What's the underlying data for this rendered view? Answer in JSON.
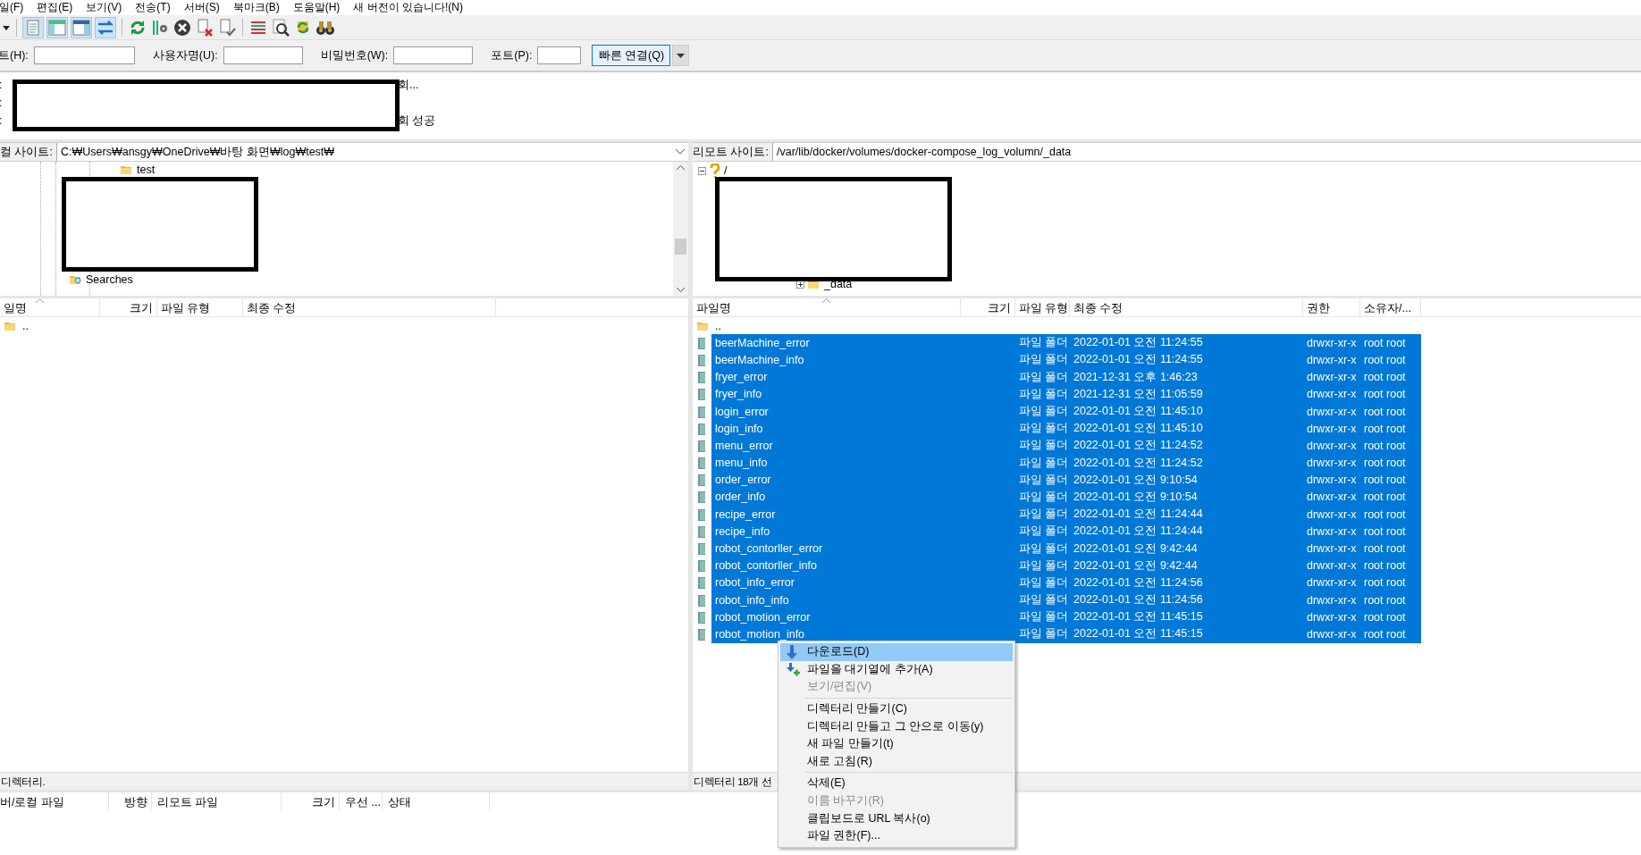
{
  "menu_bar": {
    "items": [
      "일(F)",
      "편집(E)",
      "보기(V)",
      "전송(T)",
      "서버(S)",
      "북마크(B)",
      "도움말(H)",
      "새 버전이 있습니다!(N)"
    ]
  },
  "quickconnect": {
    "fields": [
      {
        "label": "트(H):"
      },
      {
        "label": "사용자명(U):"
      },
      {
        "label": "비밀번호(W):"
      },
      {
        "label": "포트(P):"
      }
    ],
    "button": "빠른 연결(Q)"
  },
  "message_log": {
    "lines": [
      {
        "prefix": ":",
        "text": "회..."
      },
      {
        "prefix": ":"
      },
      {
        "prefix": ":",
        "text": "회 성공"
      }
    ]
  },
  "local": {
    "site_label": "컬 사이트:",
    "path": "C:₩Users₩ansgy₩OneDrive₩바탕 화면₩log₩test₩",
    "tree": [
      {
        "label": "test",
        "kind": "folder"
      },
      {
        "label": "Searches",
        "kind": "search"
      }
    ],
    "columns": [
      "일명",
      "크기",
      "파일 유형",
      "최종 수정"
    ],
    "rows": [
      {
        "name": ".."
      }
    ],
    "status": "디렉터리."
  },
  "remote": {
    "site_label": "리모트 사이트:",
    "path": "/var/lib/docker/volumes/docker-compose_log_volumn/_data",
    "tree": [
      {
        "label": "/",
        "children": [
          {
            "label": "_data"
          }
        ]
      }
    ],
    "columns": [
      "파일명",
      "크기",
      "파일 유형",
      "최종 수정",
      "권한",
      "소유자/..."
    ],
    "rows": [
      {
        "name": "..",
        "selected": false
      },
      {
        "name": "beerMachine_error",
        "type": "파일 폴더",
        "modified": "2022-01-01 오전 11:24:55",
        "permissions": "drwxr-xr-x",
        "owner": "root root",
        "selected": true
      },
      {
        "name": "beerMachine_info",
        "type": "파일 폴더",
        "modified": "2022-01-01 오전 11:24:55",
        "permissions": "drwxr-xr-x",
        "owner": "root root",
        "selected": true
      },
      {
        "name": "fryer_error",
        "type": "파일 폴더",
        "modified": "2021-12-31 오후 1:46:23",
        "permissions": "drwxr-xr-x",
        "owner": "root root",
        "selected": true
      },
      {
        "name": "fryer_info",
        "type": "파일 폴더",
        "modified": "2021-12-31 오전 11:05:59",
        "permissions": "drwxr-xr-x",
        "owner": "root root",
        "selected": true
      },
      {
        "name": "login_error",
        "type": "파일 폴더",
        "modified": "2022-01-01 오전 11:45:10",
        "permissions": "drwxr-xr-x",
        "owner": "root root",
        "selected": true
      },
      {
        "name": "login_info",
        "type": "파일 폴더",
        "modified": "2022-01-01 오전 11:45:10",
        "permissions": "drwxr-xr-x",
        "owner": "root root",
        "selected": true
      },
      {
        "name": "menu_error",
        "type": "파일 폴더",
        "modified": "2022-01-01 오전 11:24:52",
        "permissions": "drwxr-xr-x",
        "owner": "root root",
        "selected": true
      },
      {
        "name": "menu_info",
        "type": "파일 폴더",
        "modified": "2022-01-01 오전 11:24:52",
        "permissions": "drwxr-xr-x",
        "owner": "root root",
        "selected": true
      },
      {
        "name": "order_error",
        "type": "파일 폴더",
        "modified": "2022-01-01 오전 9:10:54",
        "permissions": "drwxr-xr-x",
        "owner": "root root",
        "selected": true
      },
      {
        "name": "order_info",
        "type": "파일 폴더",
        "modified": "2022-01-01 오전 9:10:54",
        "permissions": "drwxr-xr-x",
        "owner": "root root",
        "selected": true
      },
      {
        "name": "recipe_error",
        "type": "파일 폴더",
        "modified": "2022-01-01 오전 11:24:44",
        "permissions": "drwxr-xr-x",
        "owner": "root root",
        "selected": true
      },
      {
        "name": "recipe_info",
        "type": "파일 폴더",
        "modified": "2022-01-01 오전 11:24:44",
        "permissions": "drwxr-xr-x",
        "owner": "root root",
        "selected": true
      },
      {
        "name": "robot_contorller_error",
        "type": "파일 폴더",
        "modified": "2022-01-01 오전 9:42:44",
        "permissions": "drwxr-xr-x",
        "owner": "root root",
        "selected": true
      },
      {
        "name": "robot_contorller_info",
        "type": "파일 폴더",
        "modified": "2022-01-01 오전 9:42:44",
        "permissions": "drwxr-xr-x",
        "owner": "root root",
        "selected": true
      },
      {
        "name": "robot_info_error",
        "type": "파일 폴더",
        "modified": "2022-01-01 오전 11:24:56",
        "permissions": "drwxr-xr-x",
        "owner": "root root",
        "selected": true
      },
      {
        "name": "robot_info_info",
        "type": "파일 폴더",
        "modified": "2022-01-01 오전 11:24:56",
        "permissions": "drwxr-xr-x",
        "owner": "root root",
        "selected": true
      },
      {
        "name": "robot_motion_error",
        "type": "파일 폴더",
        "modified": "2022-01-01 오전 11:45:15",
        "permissions": "drwxr-xr-x",
        "owner": "root root",
        "selected": true
      },
      {
        "name": "robot_motion_info",
        "type": "파일 폴더",
        "modified": "2022-01-01 오전 11:45:15",
        "permissions": "drwxr-xr-x",
        "owner": "root root",
        "selected": true
      }
    ],
    "status": "디렉터리 18개 선"
  },
  "queue": {
    "columns": [
      "버/로컬 파일",
      "방향",
      "리모트 파일",
      "크기",
      "우선 ...",
      "상태"
    ]
  },
  "context_menu": {
    "items": [
      {
        "kind": "item",
        "label": "다운로드(D)",
        "disabled": false,
        "selected": true
      },
      {
        "kind": "item",
        "label": "파일을 대기열에 추가(A)",
        "disabled": false,
        "selected": false
      },
      {
        "kind": "item",
        "label": "보기/편집(V)",
        "disabled": true,
        "selected": false
      },
      {
        "kind": "separator"
      },
      {
        "kind": "item",
        "label": "디렉터리 만들기(C)",
        "disabled": false,
        "selected": false
      },
      {
        "kind": "item",
        "label": "디렉터리 만들고 그 안으로 이동(y)",
        "disabled": false,
        "selected": false
      },
      {
        "kind": "item",
        "label": "새 파일 만들기(t)",
        "disabled": false,
        "selected": false
      },
      {
        "kind": "item",
        "label": "새로 고침(R)",
        "disabled": false,
        "selected": false
      },
      {
        "kind": "separator"
      },
      {
        "kind": "item",
        "label": "삭제(E)",
        "disabled": false,
        "selected": false
      },
      {
        "kind": "item",
        "label": "이름 바꾸기(R)",
        "disabled": true,
        "selected": false
      },
      {
        "kind": "item",
        "label": "클립보드로 URL 복사(o)",
        "disabled": false,
        "selected": false
      },
      {
        "kind": "item",
        "label": "파일 권한(F)...",
        "disabled": false,
        "selected": false
      }
    ]
  }
}
